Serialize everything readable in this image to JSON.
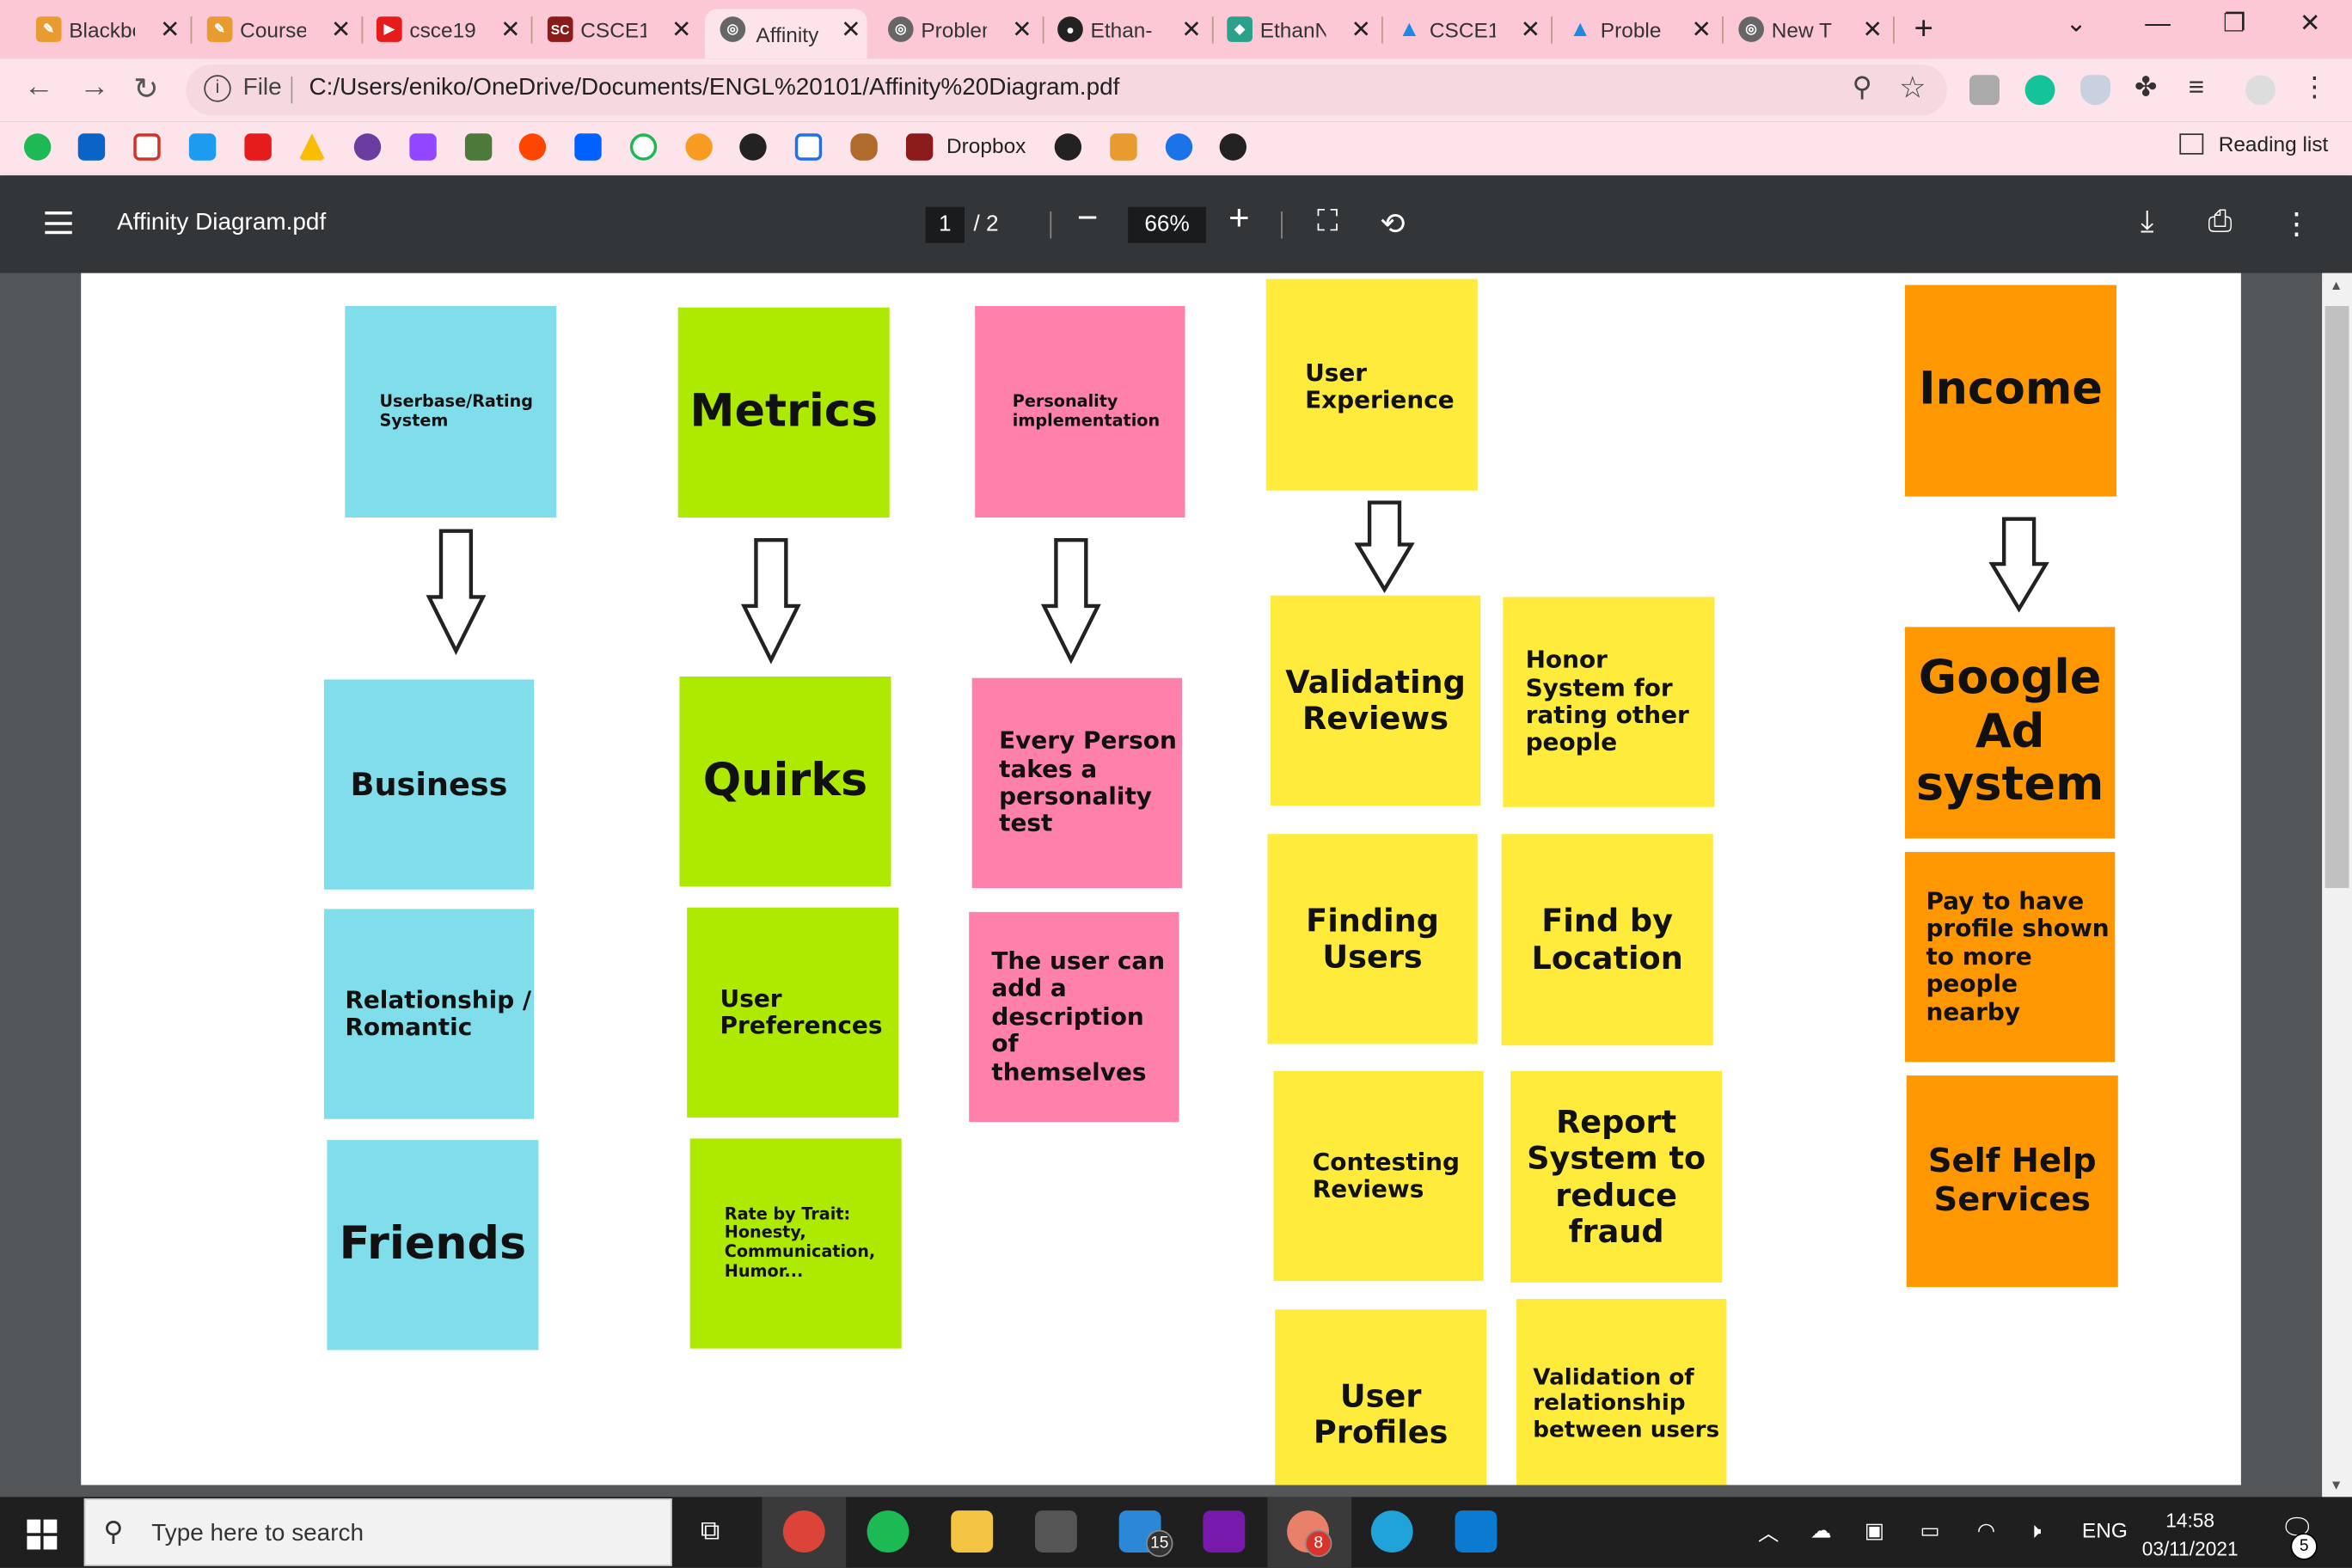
{
  "tabs": [
    {
      "title": "Blackboard",
      "fav_color": "#e89b2f",
      "active": false
    },
    {
      "title": "Course",
      "fav_color": "#e89b2f",
      "active": false
    },
    {
      "title": "csce19",
      "fav_color": "#e61c1c",
      "active": false
    },
    {
      "title": "CSCE1",
      "fav_color": "#8b1a1a",
      "active": false
    },
    {
      "title": "Affinity",
      "fav_color": "#555555",
      "active": true
    },
    {
      "title": "Problem",
      "fav_color": "#555555",
      "active": false
    },
    {
      "title": "Ethan-",
      "fav_color": "#222222",
      "active": false
    },
    {
      "title": "EthanN",
      "fav_color": "#2aa18a",
      "active": false
    },
    {
      "title": "CSCE1",
      "fav_color": "#1e88e5",
      "active": false
    },
    {
      "title": "Proble",
      "fav_color": "#1e88e5",
      "active": false
    },
    {
      "title": "New T",
      "fav_color": "#555555",
      "active": false
    }
  ],
  "address": {
    "scheme_label": "File",
    "url": "C:/Users/eniko/OneDrive/Documents/ENGL%20101/Affinity%20Diagram.pdf"
  },
  "bookmarks": {
    "dropbox_label": "Dropbox",
    "reading_list": "Reading list"
  },
  "pdf": {
    "title": "Affinity Diagram.pdf",
    "page_current": "1",
    "page_total": "/  2",
    "zoom": "66%"
  },
  "notes": {
    "userbase": "Userbase/Rating System",
    "business": "Business",
    "relationship": "Relationship / Romantic",
    "friends": "Friends",
    "metrics": "Metrics",
    "quirks": "Quirks",
    "user_prefs": "User Preferences",
    "rate_by_trait": "Rate by Trait: Honesty, Communication, Humor...",
    "personality": "Personality implementation",
    "every_person": "Every Person takes a personality test",
    "description": "The user can add a description of themselves",
    "user_experience": "User Experience",
    "validating_reviews": "Validating Reviews",
    "honor_system": "Honor System for rating other people",
    "finding_users": "Finding Users",
    "find_by_location": "Find by Location",
    "contesting_reviews": "Contesting Reviews",
    "report_system": "Report System to reduce fraud",
    "user_profiles": "User Profiles",
    "validation_relationship": "Validation of relationship between users",
    "income": "Income",
    "google_ad": "Google Ad system",
    "pay_profile": "Pay to have profile shown to more people nearby",
    "self_help": "Self Help Services"
  },
  "colors": {
    "blue": "#80deea",
    "green": "#aeea00",
    "pink": "#ff80ab",
    "yellow": "#ffeb3b",
    "orange": "#ff9800"
  },
  "taskbar": {
    "search_placeholder": "Type here to search",
    "badge_files": "15",
    "badge_discord": "8",
    "lang": "ENG",
    "time": "14:58",
    "date": "03/11/2021",
    "notif_count": "5"
  }
}
